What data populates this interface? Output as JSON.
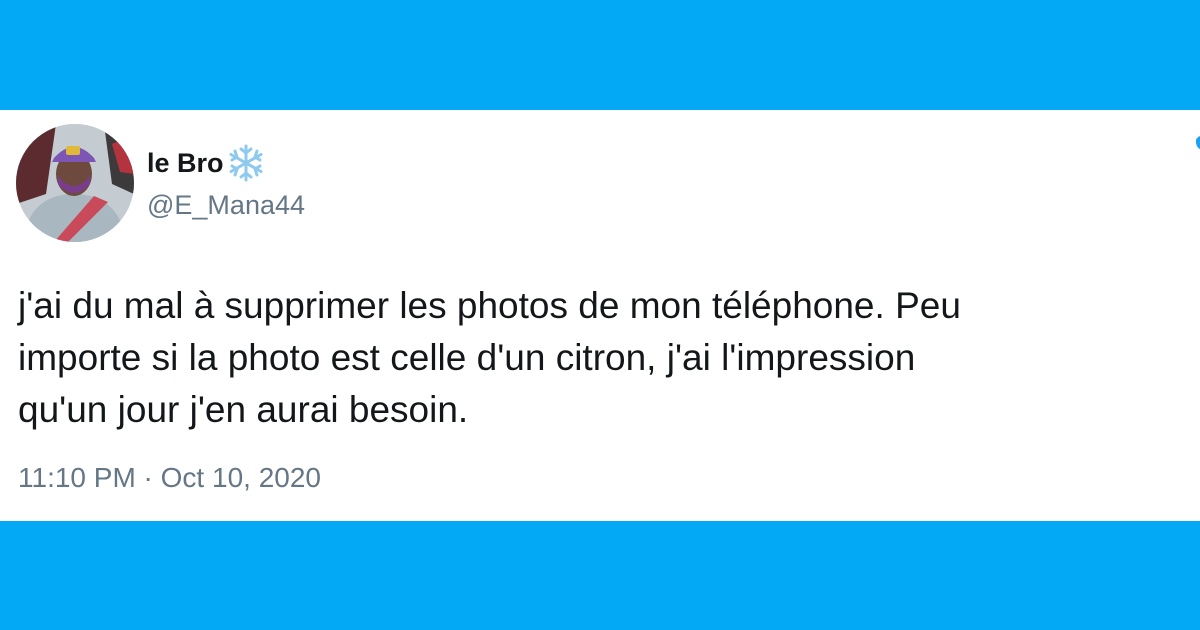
{
  "colors": {
    "background_band": "#03a9f4",
    "card": "#ffffff",
    "text_primary": "#14171a",
    "text_secondary": "#657786",
    "snowflake": "#8ec9ee"
  },
  "tweet": {
    "display_name": "le Bro",
    "name_emoji_icon": "snowflake-icon",
    "handle": "@E_Mana44",
    "text": "j'ai du mal à supprimer les photos de mon téléphone. Peu\nimporte si la photo est celle d'un citron, j'ai l'impression\nqu'un jour j'en aurai besoin.",
    "timestamp": "11:10 PM · Oct 10, 2020"
  }
}
